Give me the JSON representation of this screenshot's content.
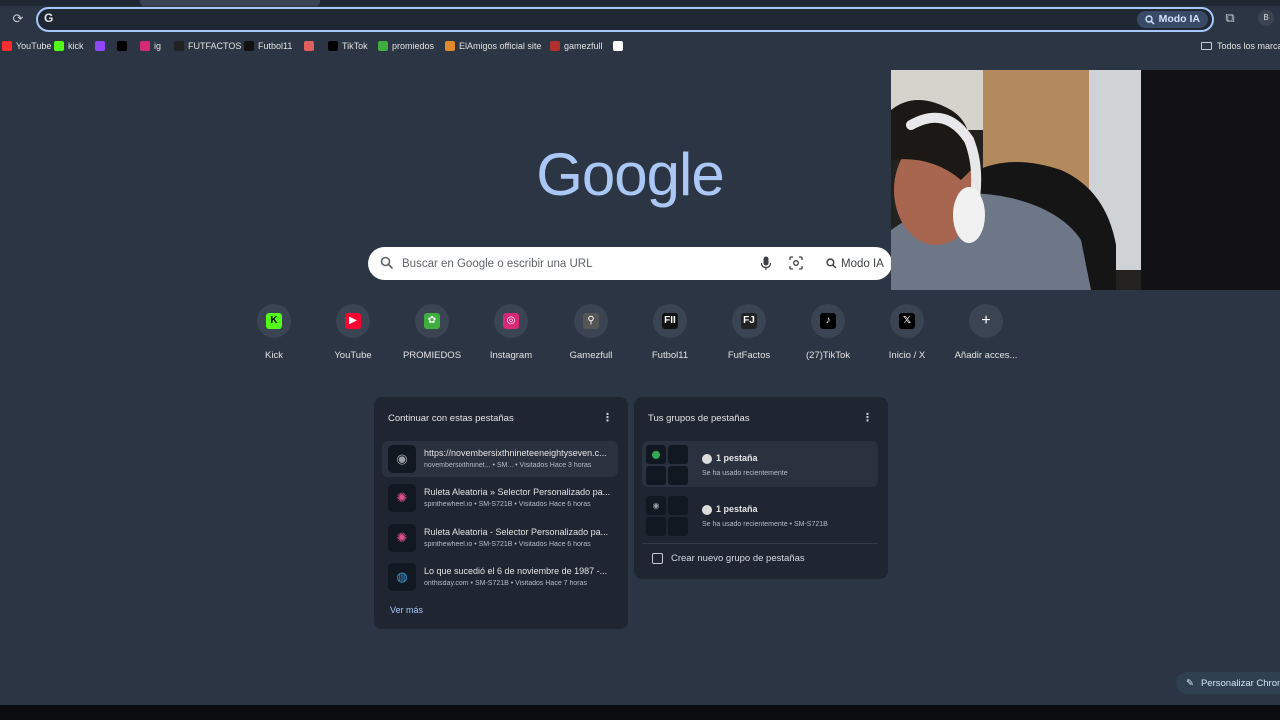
{
  "browser": {
    "omnibox": {
      "value": "",
      "ai_label": "Modo IA"
    },
    "bookmarks": [
      {
        "label": "YouTube",
        "icon": "youtube-icon",
        "color": "#ff2d2d"
      },
      {
        "label": "kick",
        "icon": "kick-icon",
        "color": "#53fc18"
      },
      {
        "label": "",
        "icon": "twitch-icon",
        "color": "#9146ff"
      },
      {
        "label": "",
        "icon": "x-icon",
        "color": "#000000"
      },
      {
        "label": "ig",
        "icon": "instagram-icon",
        "color": "#d62976"
      },
      {
        "label": "FUTFACTOS",
        "icon": "futfactos-icon",
        "color": "#222222"
      },
      {
        "label": "Futbol11",
        "icon": "futbol11-icon",
        "color": "#111111"
      },
      {
        "label": "",
        "icon": "mail-icon",
        "color": "#e06060"
      },
      {
        "label": "TikTok",
        "icon": "tiktok-icon",
        "color": "#000000"
      },
      {
        "label": "promiedos",
        "icon": "promiedos-icon",
        "color": "#3fae3f"
      },
      {
        "label": "ElAmigos official site",
        "icon": "elamigos-icon",
        "color": "#e08a2b"
      },
      {
        "label": "gamezfull",
        "icon": "gamezfull-icon",
        "color": "#b03030"
      },
      {
        "label": "",
        "icon": "diamond-icon",
        "color": "#ffffff"
      }
    ],
    "bookmarks_folder": "Todos los marcadores"
  },
  "ntp": {
    "logo_text": "Google",
    "search": {
      "placeholder": "Buscar en Google o escribir una URL",
      "ai_label": "Modo IA"
    },
    "shortcuts": [
      {
        "label": "Kick",
        "icon": "kick-icon",
        "color": "#53fc18",
        "glyph": "K"
      },
      {
        "label": "YouTube",
        "icon": "youtube-icon",
        "color": "#ff0033",
        "glyph": "▶"
      },
      {
        "label": "PROMIEDOS",
        "icon": "promiedos-icon",
        "color": "#3fae3f",
        "glyph": "✿"
      },
      {
        "label": "Instagram",
        "icon": "instagram-icon",
        "color": "#d62976",
        "glyph": "◎"
      },
      {
        "label": "Gamezfull",
        "icon": "gamezfull-icon",
        "color": "#555555",
        "glyph": "⚲"
      },
      {
        "label": "Futbol11",
        "icon": "futbol11-icon",
        "color": "#111111",
        "glyph": "FII"
      },
      {
        "label": "FutFactos",
        "icon": "futfactos-icon",
        "color": "#222222",
        "glyph": "FJ"
      },
      {
        "label": "(27)TikTok",
        "icon": "tiktok-icon",
        "color": "#000000",
        "glyph": "♪"
      },
      {
        "label": "Inicio / X",
        "icon": "x-icon",
        "color": "#000000",
        "glyph": "𝕏"
      },
      {
        "label": "Añadir acces...",
        "icon": "plus-icon",
        "color": "#3a4452",
        "glyph": "+"
      }
    ],
    "continue_card": {
      "title": "Continuar con estas pestañas",
      "tabs": [
        {
          "title": "https://novembersixthnineteeneightyseven.c...",
          "sub": "novembersixthninet... • SM... • Visitados Hace 3 horas",
          "icon": "globe-icon"
        },
        {
          "title": "Ruleta Aleatoria » Selector Personalizado pa...",
          "sub": "spinthewheel.io • SM-S721B • Visitados Hace 6 horas",
          "icon": "wheel-icon"
        },
        {
          "title": "Ruleta Aleatoria - Selector Personalizado pa...",
          "sub": "spinthewheel.io • SM-S721B • Visitados Hace 6 horas",
          "icon": "wheel-icon"
        },
        {
          "title": "Lo que sucedió el 6 de noviembre de 1987 -...",
          "sub": "onthisday.com • SM-S721B • Visitados Hace 7 horas",
          "icon": "onthisday-icon"
        }
      ],
      "more_label": "Ver más"
    },
    "groups_card": {
      "title": "Tus grupos de pestañas",
      "groups": [
        {
          "count": "1 pestaña",
          "sub": "Se ha usado recientemente",
          "icon": "maps-icon"
        },
        {
          "count": "1 pestaña",
          "sub": "Se ha usado recientemente • SM-S721B",
          "icon": "globe-icon"
        }
      ],
      "new_group_label": "Crear nuevo grupo de pestañas"
    },
    "customize_label": "Personalizar Chrome"
  }
}
